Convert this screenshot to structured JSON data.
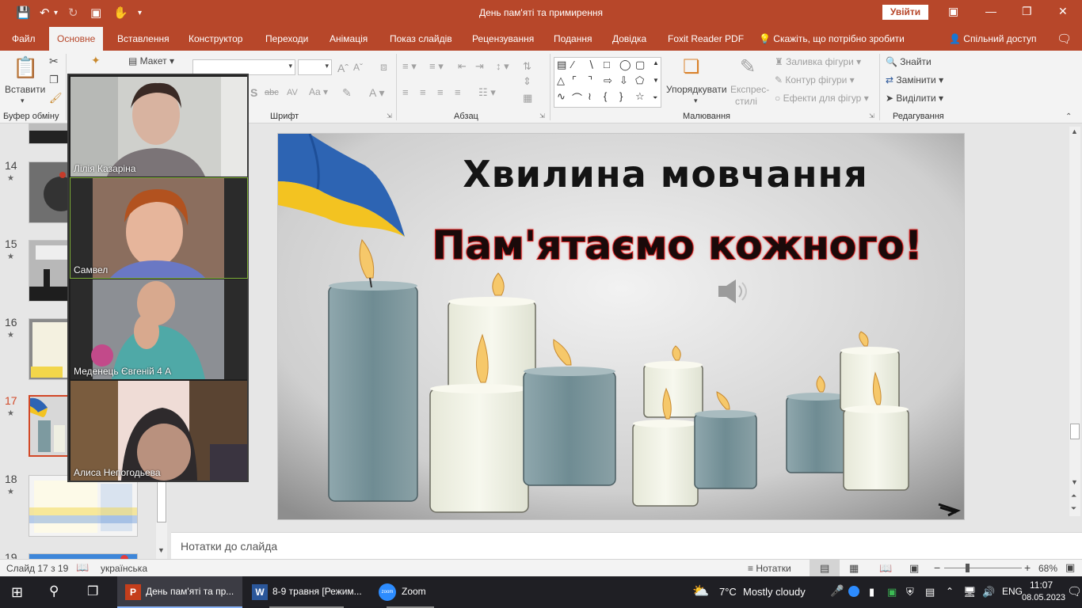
{
  "window": {
    "doc_title": "День пам'яті та примирення",
    "signin_label": "Увійти"
  },
  "tabs": {
    "file": "Файл",
    "home": "Основне",
    "insert": "Вставлення",
    "design": "Конструктор",
    "transitions": "Переходи",
    "animations": "Анімація",
    "slideshow": "Показ слайдів",
    "review": "Рецензування",
    "view": "Подання",
    "help": "Довідка",
    "foxit": "Foxit Reader PDF",
    "tell_me": "Скажіть, що потрібно зробити",
    "share": "Спільний доступ"
  },
  "ribbon": {
    "paste_label": "Вставити",
    "layout_label": "Макет",
    "clipboard_group": "Буфер обміну",
    "font_group": "Шрифт",
    "paragraph_group": "Абзац",
    "drawing_group": "Малювання",
    "editing_group": "Редагування",
    "arrange_label": "Упорядкувати",
    "quick_styles_label_1": "Експрес-",
    "quick_styles_label_2": "стилі",
    "shape_fill": "Заливка фігури",
    "shape_outline": "Контур фігури",
    "shape_effects": "Ефекти для фігур",
    "find": "Знайти",
    "replace": "Замінити",
    "select": "Виділити"
  },
  "thumbnails": [
    {
      "num": "14"
    },
    {
      "num": "15"
    },
    {
      "num": "16"
    },
    {
      "num": "17"
    },
    {
      "num": "18"
    },
    {
      "num": "19"
    }
  ],
  "participants": [
    {
      "name": "Лілія Казаріна"
    },
    {
      "name": "Самвел"
    },
    {
      "name": "Меденець Євгеній 4 А"
    },
    {
      "name": "Алиса Непогодьева"
    }
  ],
  "slide": {
    "title": "Хвилина мовчання",
    "subtitle": "Пам'ятаємо кожного!"
  },
  "notes": {
    "placeholder": "Нотатки до слайда"
  },
  "statusbar": {
    "slide_position": "Слайд 17 з 19",
    "language": "українська",
    "notes_label": "Нотатки",
    "zoom_level": "68%",
    "zoom_fraction": 0.3
  },
  "taskbar": {
    "ppt_item": "День пам'яті та пр...",
    "word_item": "8-9 травня [Режим...",
    "zoom_item": "Zoom",
    "weather_temp": "7°C",
    "weather_text": "Mostly cloudy",
    "keyboard_lang": "ENG",
    "time": "11:07",
    "date": "08.05.2023"
  },
  "colors": {
    "accent": "#b7472a",
    "selected_thumb_border": "#d24726",
    "subtitle_stroke": "#d61f1f"
  }
}
